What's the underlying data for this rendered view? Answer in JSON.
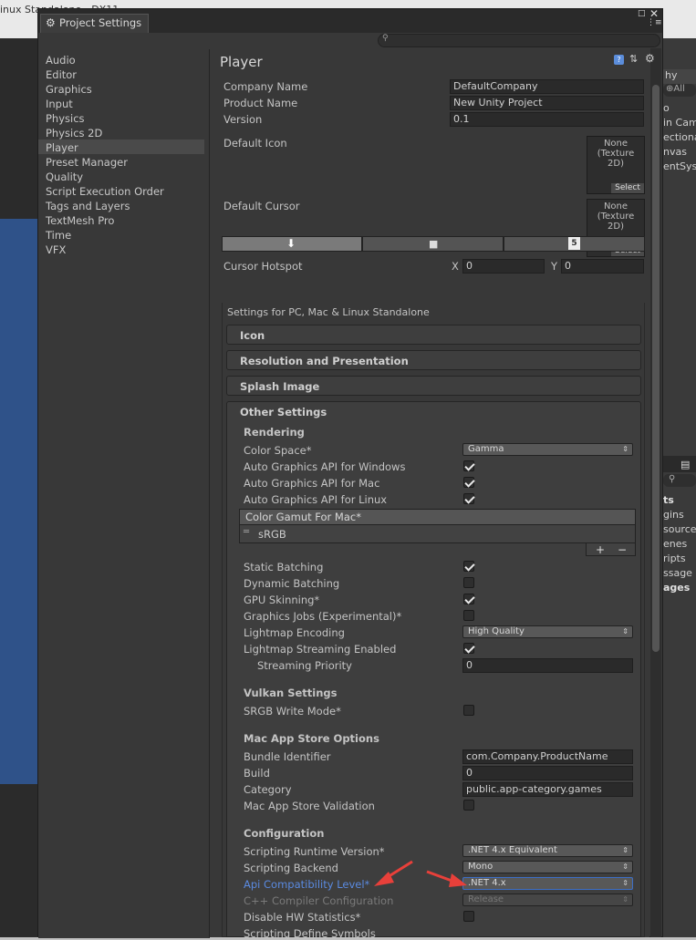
{
  "background": {
    "title_fragment": "inux Standalone - DX11",
    "right_panel": {
      "tab_partial": "hy",
      "search_placeholder": "⊕All",
      "items": [
        "o",
        "in Cam",
        "ectional",
        "nvas",
        "entSyst"
      ],
      "tab2_items": [
        "ts",
        "gins",
        "source",
        "enes",
        "ripts",
        "ssage",
        "ages"
      ]
    }
  },
  "window": {
    "tab_title": "Project Settings",
    "nav": [
      "Audio",
      "Editor",
      "Graphics",
      "Input",
      "Physics",
      "Physics 2D",
      "Player",
      "Preset Manager",
      "Quality",
      "Script Execution Order",
      "Tags and Layers",
      "TextMesh Pro",
      "Time",
      "VFX"
    ],
    "selected_nav": "Player"
  },
  "player": {
    "title": "Player",
    "company_name_label": "Company Name",
    "company_name": "DefaultCompany",
    "product_name_label": "Product Name",
    "product_name": "New Unity Project",
    "version_label": "Version",
    "version": "0.1",
    "default_icon_label": "Default Icon",
    "default_cursor_label": "Default Cursor",
    "texture_none": "None\n(Texture\n2D)",
    "select_label": "Select",
    "cursor_hotspot_label": "Cursor Hotspot",
    "hotspot_x_label": "X",
    "hotspot_x": "0",
    "hotspot_y_label": "Y",
    "hotspot_y": "0",
    "platform_settings_title": "Settings for PC, Mac & Linux Standalone",
    "sections": {
      "icon": "Icon",
      "resolution": "Resolution and Presentation",
      "splash": "Splash Image",
      "other": "Other Settings"
    }
  },
  "other_settings": {
    "rendering_header": "Rendering",
    "color_space_label": "Color Space*",
    "color_space": "Gamma",
    "auto_windows_label": "Auto Graphics API  for Windows",
    "auto_windows": true,
    "auto_mac_label": "Auto Graphics API  for Mac",
    "auto_mac": true,
    "auto_linux_label": "Auto Graphics API  for Linux",
    "auto_linux": true,
    "color_gamut_header": "Color Gamut For Mac*",
    "color_gamut_item": "sRGB",
    "list_add": "+",
    "list_remove": "−",
    "static_batching_label": "Static Batching",
    "static_batching": true,
    "dynamic_batching_label": "Dynamic Batching",
    "dynamic_batching": false,
    "gpu_skinning_label": "GPU Skinning*",
    "gpu_skinning": true,
    "graphics_jobs_label": "Graphics Jobs (Experimental)*",
    "graphics_jobs": false,
    "lightmap_encoding_label": "Lightmap Encoding",
    "lightmap_encoding": "High Quality",
    "lightmap_streaming_label": "Lightmap Streaming Enabled",
    "lightmap_streaming": true,
    "streaming_priority_label": "Streaming Priority",
    "streaming_priority": "0",
    "vulkan_header": "Vulkan Settings",
    "srgb_write_label": "SRGB Write Mode*",
    "srgb_write": false,
    "mac_store_header": "Mac App Store Options",
    "bundle_id_label": "Bundle Identifier",
    "bundle_id": "com.Company.ProductName",
    "build_label": "Build",
    "build": "0",
    "category_label": "Category",
    "category": "public.app-category.games",
    "mac_validation_label": "Mac App Store Validation",
    "mac_validation": false,
    "configuration_header": "Configuration",
    "runtime_version_label": "Scripting Runtime Version*",
    "runtime_version": ".NET 4.x Equivalent",
    "backend_label": "Scripting Backend",
    "backend": "Mono",
    "api_level_label": "Api Compatibility Level*",
    "api_level": ".NET 4.x",
    "cpp_config_label": "C++ Compiler Configuration",
    "cpp_config": "Release",
    "disable_hw_label": "Disable HW Statistics*",
    "disable_hw": false,
    "define_symbols_label": "Scripting Define Symbols"
  },
  "colors": {
    "annotation_arrow": "#e8403a",
    "highlight_label": "#5a8ae0"
  }
}
